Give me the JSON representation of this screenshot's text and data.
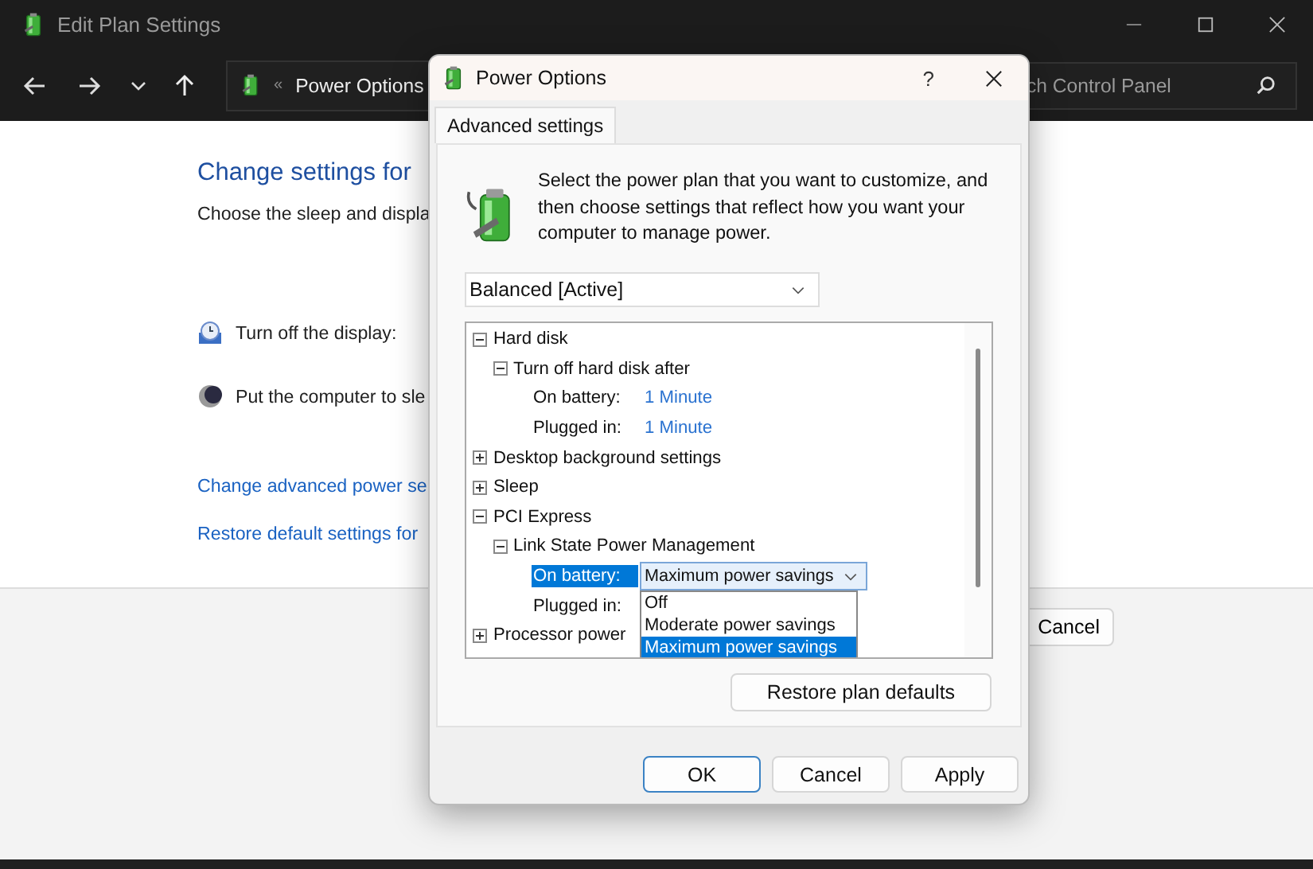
{
  "background_window": {
    "title": "Edit Plan Settings",
    "address": {
      "separator": "«",
      "location": "Power Options"
    },
    "search": {
      "placeholder": "ch Control Panel"
    },
    "heading": "Change settings for",
    "subtitle": "Choose the sleep and displa",
    "settings": [
      {
        "kind": "display",
        "label": "Turn off the display:"
      },
      {
        "kind": "sleep",
        "label": "Put the computer to sle"
      }
    ],
    "links": [
      "Change advanced power se",
      "Restore default settings for"
    ],
    "footer_buttons": [
      "Cancel"
    ]
  },
  "dialog": {
    "title": "Power Options",
    "help": "?",
    "tabs": [
      {
        "label": "Advanced settings",
        "selected": true
      }
    ],
    "intro": "Select the power plan that you want to customize, and then choose settings that reflect how you want your computer to manage power.",
    "plan_select": {
      "value": "Balanced [Active]"
    },
    "tree": [
      {
        "kind": "group",
        "label": "Hard disk",
        "expanded": true,
        "children": [
          {
            "kind": "group",
            "label": "Turn off hard disk after",
            "expanded": true,
            "children": [
              {
                "kind": "setting",
                "label": "On battery:",
                "value": "1 Minute",
                "selected": false
              },
              {
                "kind": "setting",
                "label": "Plugged in:",
                "value": "1 Minute",
                "selected": false
              }
            ]
          }
        ]
      },
      {
        "kind": "group",
        "label": "Desktop background settings",
        "expanded": false
      },
      {
        "kind": "group",
        "label": "Sleep",
        "expanded": false
      },
      {
        "kind": "group",
        "label": "PCI Express",
        "expanded": true,
        "children": [
          {
            "kind": "group",
            "label": "Link State Power Management",
            "expanded": true,
            "children": [
              {
                "kind": "setting",
                "label": "On battery:",
                "value": "Maximum power savings",
                "selected": true,
                "options": [
                  {
                    "label": "Off",
                    "selected": false
                  },
                  {
                    "label": "Moderate power savings",
                    "selected": false
                  },
                  {
                    "label": "Maximum power savings",
                    "selected": true
                  }
                ]
              },
              {
                "kind": "setting",
                "label": "Plugged in:",
                "selected": false
              }
            ]
          }
        ]
      },
      {
        "kind": "group",
        "label": "Processor power",
        "expanded": false
      }
    ],
    "restore_button": "Restore plan defaults",
    "buttons": [
      {
        "label": "OK",
        "default": true
      },
      {
        "label": "Cancel",
        "default": false
      },
      {
        "label": "Apply",
        "default": false
      }
    ]
  }
}
